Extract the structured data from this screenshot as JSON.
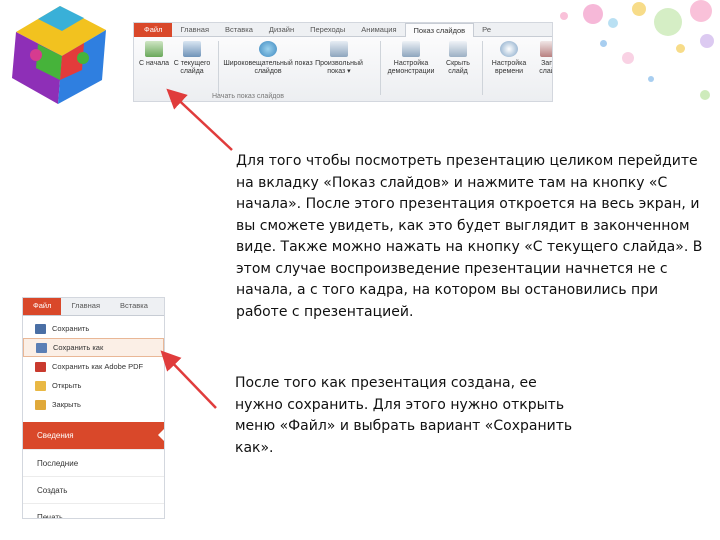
{
  "ribbon": {
    "tabs": [
      "Файл",
      "Главная",
      "Вставка",
      "Дизайн",
      "Переходы",
      "Анимация",
      "Показ слайдов",
      "Ре"
    ],
    "active_tab": "Показ слайдов",
    "buttons": [
      {
        "label": "С начала"
      },
      {
        "label": "С текущего слайда"
      },
      {
        "label": "Широковещательный показ слайдов"
      },
      {
        "label": "Произвольный показ ▾"
      },
      {
        "label": "Настройка демонстрации"
      },
      {
        "label": "Скрыть слайд"
      },
      {
        "label": "Настройка времени"
      },
      {
        "label": "Запи слайд"
      }
    ],
    "group_label": "Начать показ слайдов"
  },
  "file_menu": {
    "tabs": [
      "Файл",
      "Главная",
      "Вставка"
    ],
    "items": [
      "Сохранить",
      "Сохранить как",
      "Сохранить как Adobe PDF",
      "Открыть",
      "Закрыть"
    ],
    "sections": [
      "Сведения",
      "Последние",
      "Создать",
      "Печать"
    ]
  },
  "text": {
    "para1": "Для того чтобы посмотреть презентацию целиком перейдите на вкладку «Показ слайдов» и нажмите там на кнопку «С начала». После этого презентация откроется на весь экран, и вы сможете увидеть, как это будет выглядит в законченном виде. Также можно нажать на кнопку «С текущего слайда». В этом случае воспроизведение презентации начнется не с начала, а с того кадра, на котором вы остановились при работе с презентацией.",
    "para2": "После того как презентация создана, ее нужно сохранить. Для этого нужно открыть меню «Файл» и выбрать вариант «Сохранить как»."
  },
  "colors": {
    "file_tab": "#d9482a",
    "arrow": "#e03c3c",
    "highlight": "#fbefe6"
  }
}
